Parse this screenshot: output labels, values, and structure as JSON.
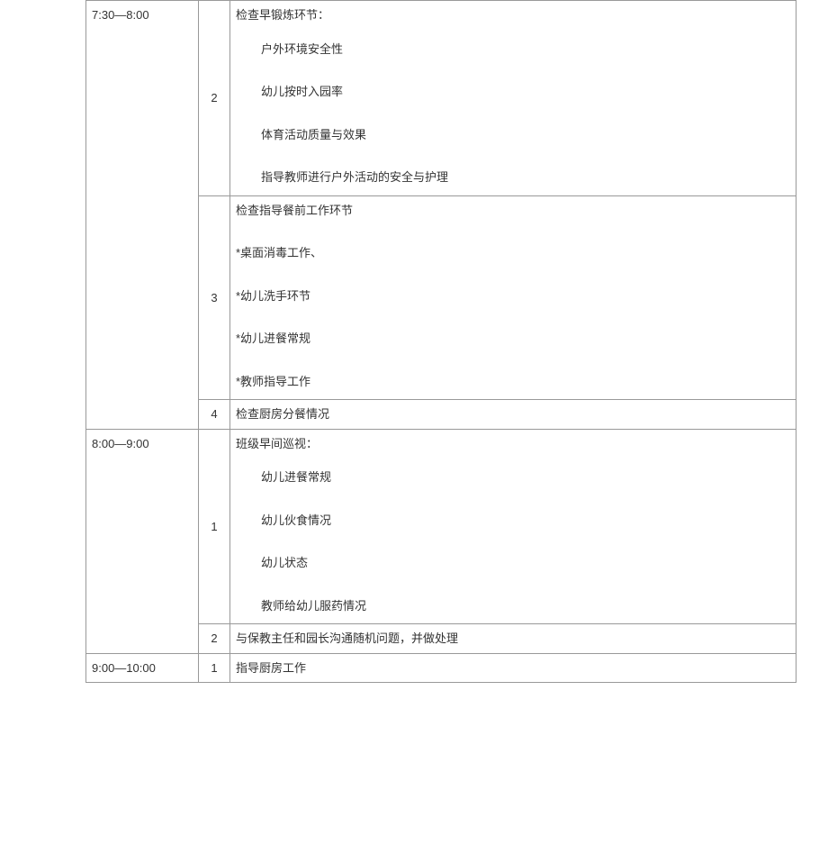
{
  "rows": [
    {
      "time": "7:30—8:00",
      "subs": [
        {
          "num": "2",
          "desc_type": "list",
          "head": "检查早锻炼环节：",
          "items": [
            "户外环境安全性",
            "幼儿按时入园率",
            "体育活动质量与效果",
            "指导教师进行户外活动的安全与护理"
          ]
        },
        {
          "num": "3",
          "desc_type": "lines",
          "lines": [
            "检查指导餐前工作环节",
            "*桌面消毒工作、",
            "*幼儿洗手环节",
            "*幼儿进餐常规",
            "*教师指导工作"
          ]
        },
        {
          "num": "4",
          "desc_type": "single",
          "text": "检查厨房分餐情况"
        }
      ]
    },
    {
      "time": "8:00—9:00",
      "subs": [
        {
          "num": "1",
          "desc_type": "list",
          "head": "班级早间巡视：",
          "items": [
            "幼儿进餐常规",
            "幼儿伙食情况",
            "幼儿状态",
            "教师给幼儿服药情况"
          ]
        },
        {
          "num": "2",
          "desc_type": "single",
          "text": "与保教主任和园长沟通随机问题，并做处理"
        }
      ]
    },
    {
      "time": "9:00—10:00",
      "subs": [
        {
          "num": "1",
          "desc_type": "single",
          "text": "指导厨房工作"
        }
      ]
    }
  ]
}
